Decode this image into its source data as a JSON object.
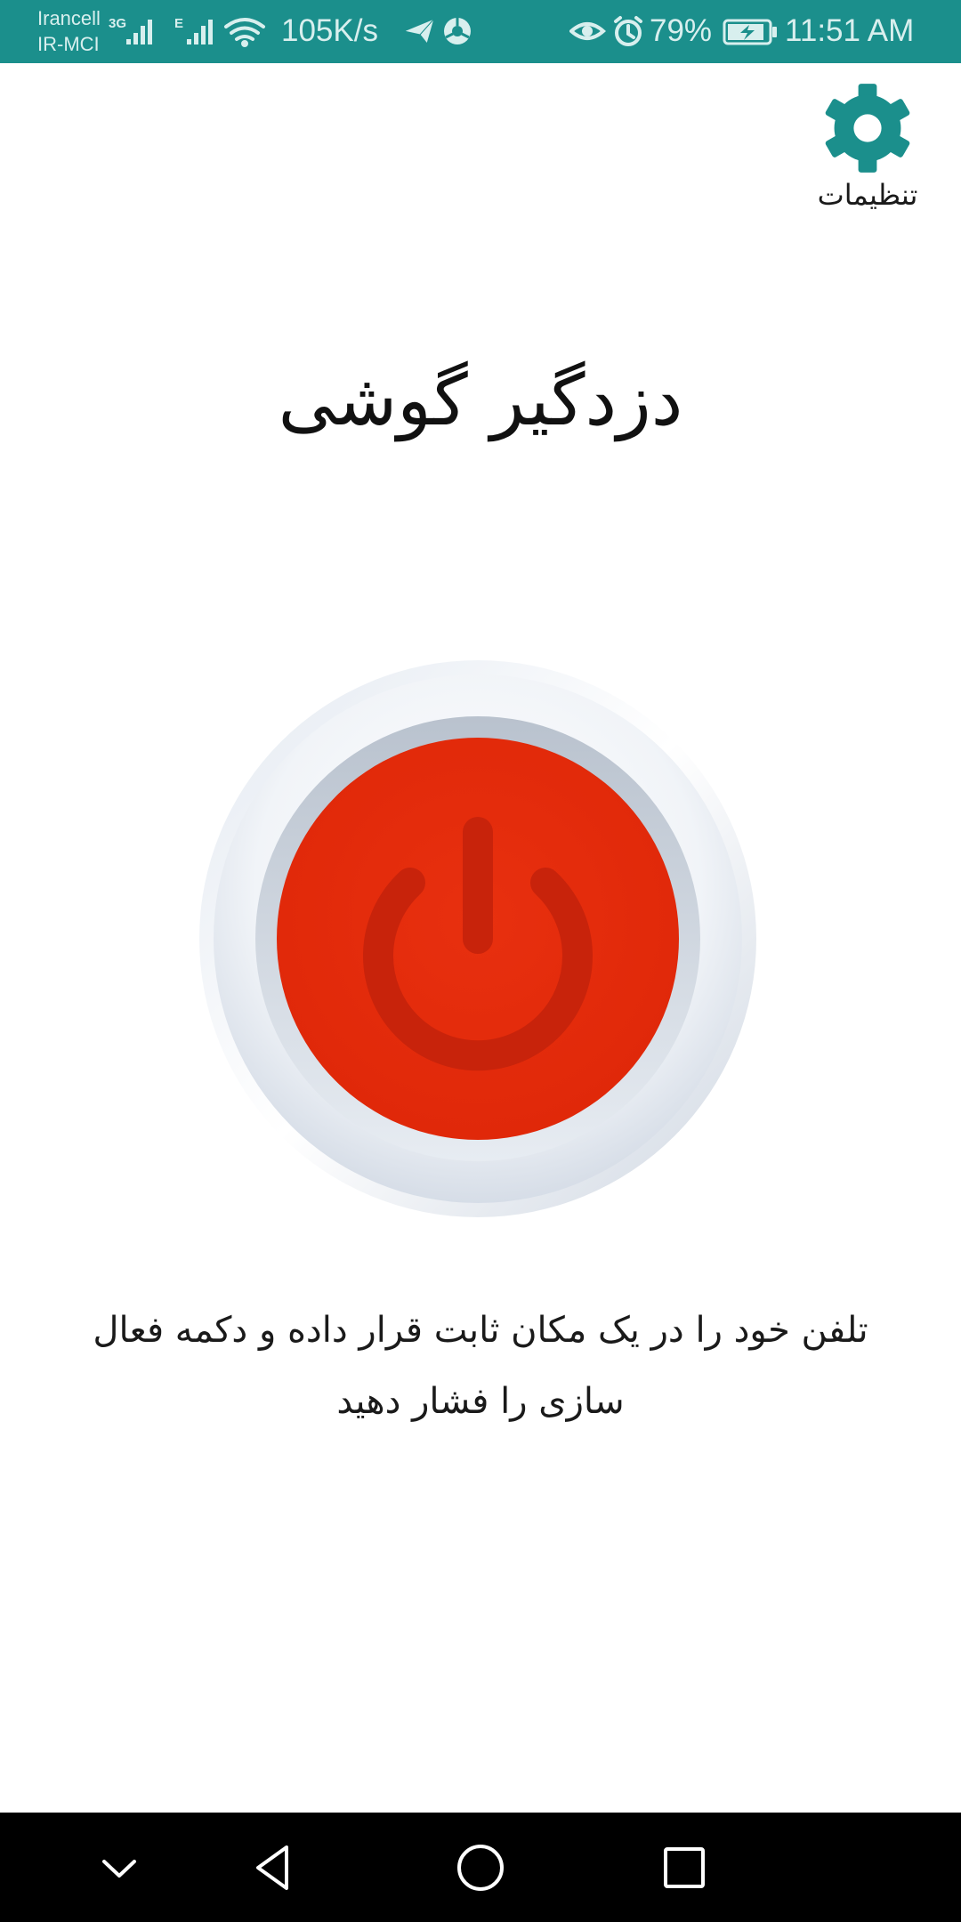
{
  "status_bar": {
    "carrier_1": "Irancell",
    "carrier_2": "IR-MCI",
    "net_type_1": "3G",
    "net_type_2": "E",
    "net_speed": "105K/s",
    "battery_percent": "79%",
    "time": "11:51 AM",
    "icons": [
      "signal-icon",
      "wifi-icon",
      "telegram-icon",
      "chrome-icon",
      "eye-icon",
      "alarm-icon",
      "battery-charging-icon"
    ]
  },
  "settings": {
    "label": "تنظیمات",
    "icon": "gear-icon"
  },
  "title": "دزدگیر گوشی",
  "power_button": {
    "icon": "power-icon",
    "color": "#e52a0b"
  },
  "instructions": {
    "text": "تلفن خود را در یک مکان ثابت قرار داده و دکمه فعال سازی را فشار دهید"
  },
  "nav_bar": {
    "buttons": [
      "hide-keyboard-icon",
      "back-icon",
      "home-icon",
      "recents-icon"
    ]
  },
  "colors": {
    "status_bar": "#1b8f8c",
    "accent": "#1b8f8c",
    "power_red": "#e52a0b",
    "nav_bar": "#000000"
  }
}
